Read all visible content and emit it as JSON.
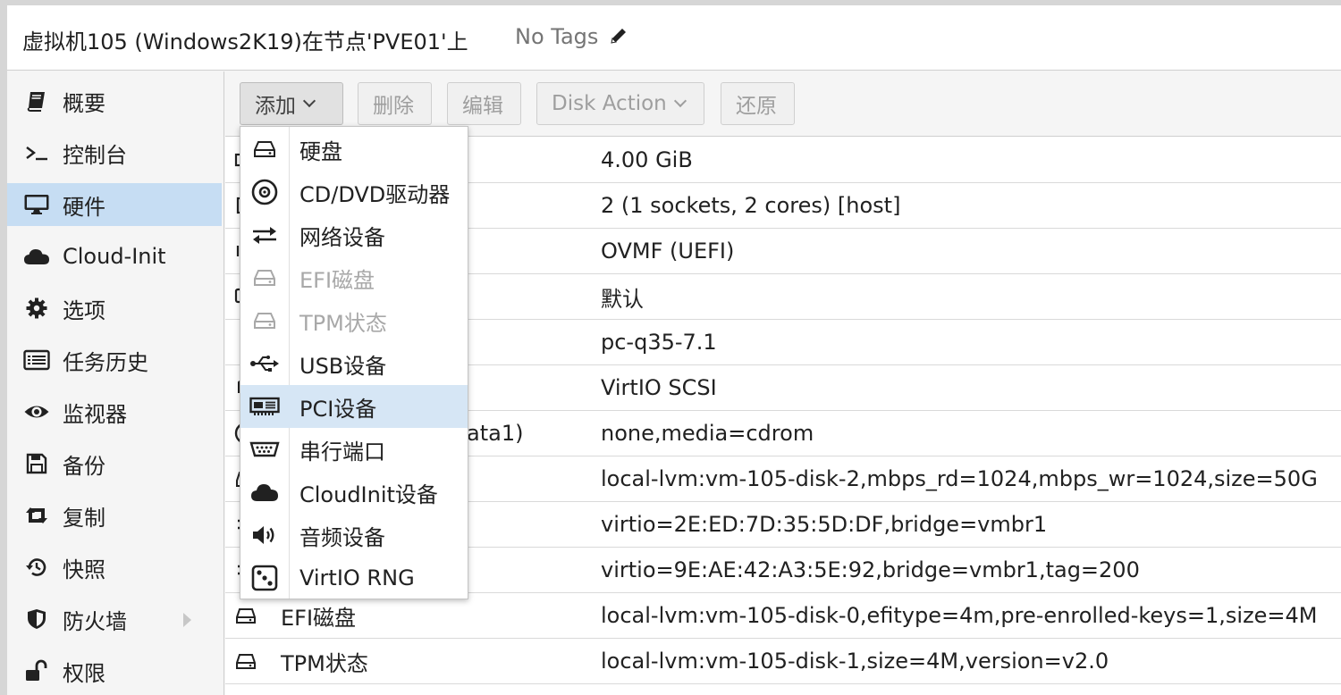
{
  "header": {
    "title": "虚拟机105 (Windows2K19)在节点'PVE01'上",
    "tags": "No Tags"
  },
  "sidebar": {
    "items": [
      {
        "label": "概要",
        "icon": "book-icon"
      },
      {
        "label": "控制台",
        "icon": "terminal-icon"
      },
      {
        "label": "硬件",
        "icon": "desktop-icon",
        "active": true
      },
      {
        "label": "Cloud-Init",
        "icon": "cloud-icon"
      },
      {
        "label": "选项",
        "icon": "gear-icon"
      },
      {
        "label": "任务历史",
        "icon": "list-icon"
      },
      {
        "label": "监视器",
        "icon": "eye-icon"
      },
      {
        "label": "备份",
        "icon": "floppy-icon"
      },
      {
        "label": "复制",
        "icon": "retweet-icon"
      },
      {
        "label": "快照",
        "icon": "history-icon"
      },
      {
        "label": "防火墙",
        "icon": "shield-icon"
      },
      {
        "label": "权限",
        "icon": "unlock-icon"
      }
    ]
  },
  "toolbar": {
    "add": "添加",
    "remove": "删除",
    "edit": "编辑",
    "disk_action": "Disk Action",
    "revert": "还原"
  },
  "rows": [
    {
      "name": "",
      "value": "4.00 GiB"
    },
    {
      "name": "",
      "value": "2 (1 sockets, 2 cores) [host]"
    },
    {
      "name": "",
      "value": "OVMF (UEFI)"
    },
    {
      "name": "",
      "value": "默认"
    },
    {
      "name": "",
      "value": "pc-q35-7.1"
    },
    {
      "name": "",
      "value": "VirtIO SCSI"
    },
    {
      "name": "ata1)",
      "value": "none,media=cdrom"
    },
    {
      "name": "",
      "value": "local-lvm:vm-105-disk-2,mbps_rd=1024,mbps_wr=1024,size=50G"
    },
    {
      "name": "",
      "value": "virtio=2E:ED:7D:35:5D:DF,bridge=vmbr1"
    },
    {
      "name": "",
      "value": "virtio=9E:AE:42:A3:5E:92,bridge=vmbr1,tag=200"
    },
    {
      "name": "EFI磁盘",
      "value": "local-lvm:vm-105-disk-0,efitype=4m,pre-enrolled-keys=1,size=4M"
    },
    {
      "name": "TPM状态",
      "value": "local-lvm:vm-105-disk-1,size=4M,version=v2.0"
    }
  ],
  "menu": {
    "items": [
      {
        "label": "硬盘",
        "icon": "hdd-icon"
      },
      {
        "label": "CD/DVD驱动器",
        "icon": "disc-icon"
      },
      {
        "label": "网络设备",
        "icon": "exchange-icon"
      },
      {
        "label": "EFI磁盘",
        "icon": "hdd-icon",
        "disabled": true
      },
      {
        "label": "TPM状态",
        "icon": "hdd-icon",
        "disabled": true
      },
      {
        "label": "USB设备",
        "icon": "usb-icon"
      },
      {
        "label": "PCI设备",
        "icon": "pci-card-icon",
        "highlighted": true
      },
      {
        "label": "串行端口",
        "icon": "serial-port-icon"
      },
      {
        "label": "CloudInit设备",
        "icon": "cloud-icon"
      },
      {
        "label": "音频设备",
        "icon": "volume-icon"
      },
      {
        "label": "VirtIO RNG",
        "icon": "dice-icon"
      }
    ]
  },
  "colors": {
    "active_bg": "#c6ddf3",
    "highlight_bg": "#d6e6f5",
    "disabled_text": "#a8a8a8"
  }
}
